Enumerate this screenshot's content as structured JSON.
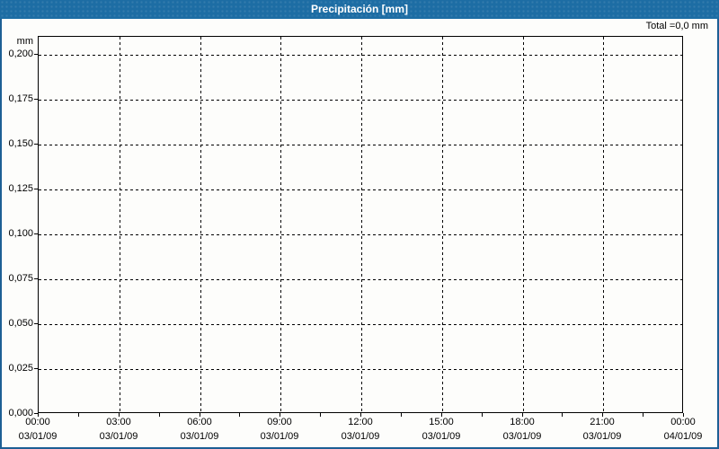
{
  "window": {
    "title": "Precipitación [mm]",
    "colors": {
      "titlebar": "#1d6da4",
      "frame_border": "#1d5f94",
      "background": "#fdfdfb",
      "plot_border": "#000000",
      "grid": "#000000",
      "title_text": "#ffffff",
      "label_text": "#000000"
    }
  },
  "chart_data": {
    "type": "bar",
    "title": "Precipitación [mm]",
    "unit_label": "mm",
    "total_label": "Total =0,0 mm",
    "total_value_mm": 0.0,
    "grid": true,
    "ylim": [
      0,
      0.21
    ],
    "xlim_hours": [
      0,
      24
    ],
    "y_ticks": [
      {
        "value": 0.2,
        "label": "0,200"
      },
      {
        "value": 0.175,
        "label": "0,175"
      },
      {
        "value": 0.15,
        "label": "0,150"
      },
      {
        "value": 0.125,
        "label": "0,125"
      },
      {
        "value": 0.1,
        "label": "0,100"
      },
      {
        "value": 0.075,
        "label": "0,075"
      },
      {
        "value": 0.05,
        "label": "0,050"
      },
      {
        "value": 0.025,
        "label": "0,025"
      },
      {
        "value": 0.0,
        "label": "0,000"
      }
    ],
    "x_ticks": [
      {
        "hour": 0,
        "time": "00:00",
        "date": "03/01/09"
      },
      {
        "hour": 3,
        "time": "03:00",
        "date": "03/01/09"
      },
      {
        "hour": 6,
        "time": "06:00",
        "date": "03/01/09"
      },
      {
        "hour": 9,
        "time": "09:00",
        "date": "03/01/09"
      },
      {
        "hour": 12,
        "time": "12:00",
        "date": "03/01/09"
      },
      {
        "hour": 15,
        "time": "15:00",
        "date": "03/01/09"
      },
      {
        "hour": 18,
        "time": "18:00",
        "date": "03/01/09"
      },
      {
        "hour": 21,
        "time": "21:00",
        "date": "03/01/09"
      },
      {
        "hour": 24,
        "time": "00:00",
        "date": "04/01/09"
      }
    ],
    "minor_x_tick_step_hours": 1.5,
    "series": [
      {
        "name": "Precipitación",
        "values": []
      }
    ]
  }
}
